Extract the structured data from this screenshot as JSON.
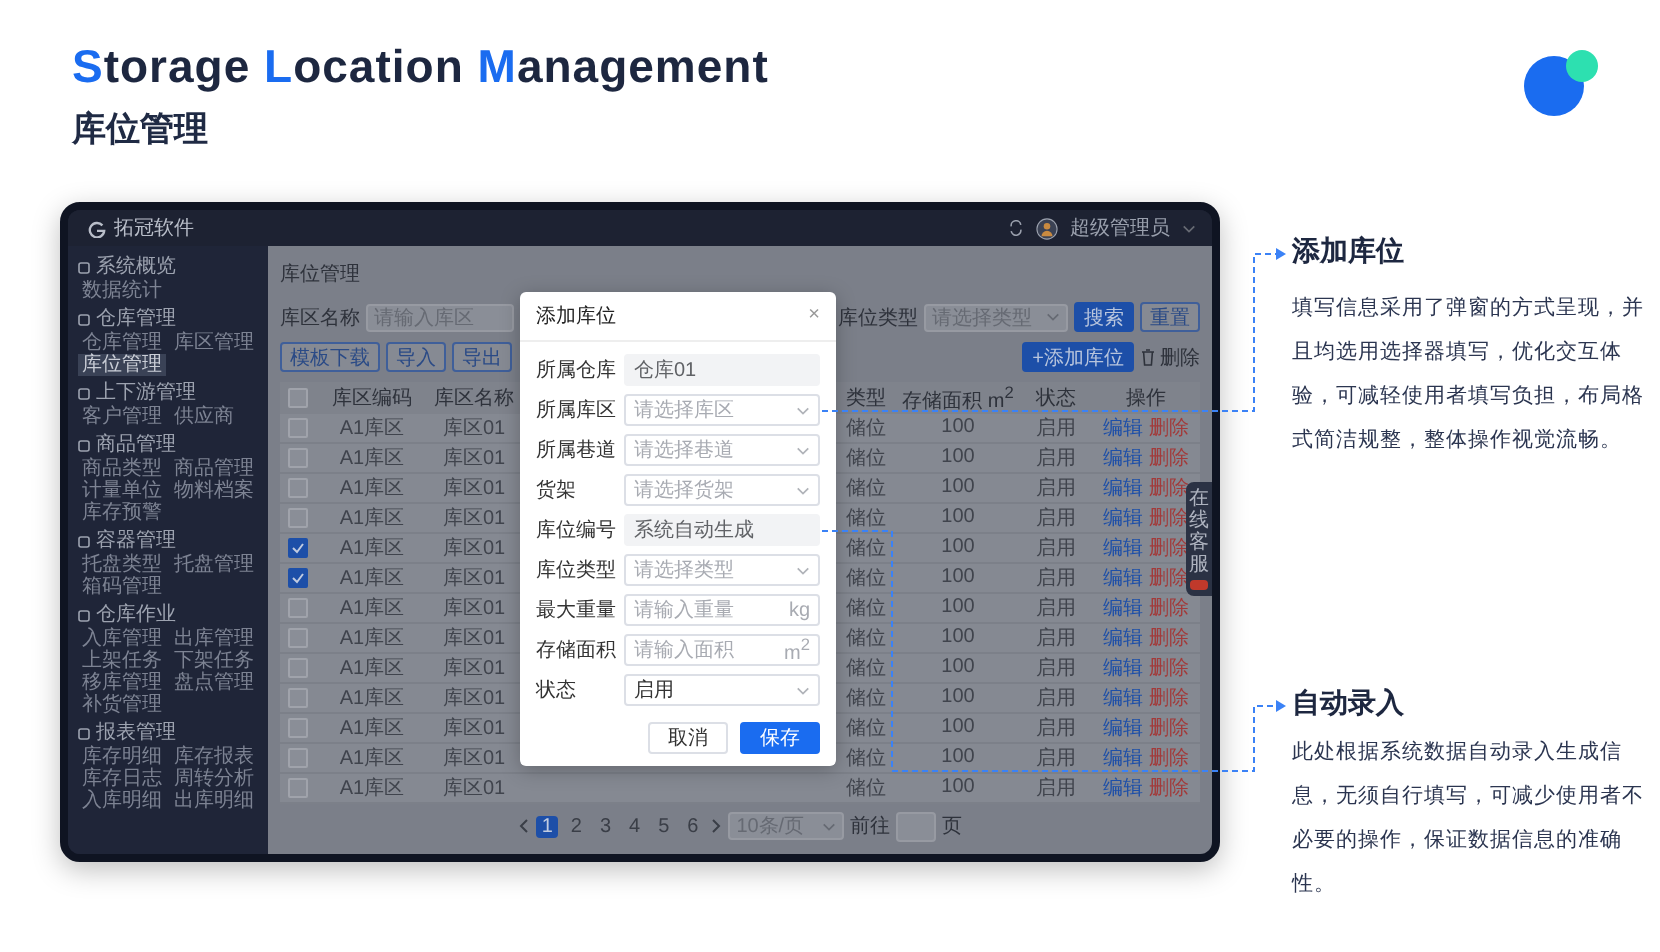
{
  "header": {
    "title_words": [
      {
        "initial": "S",
        "rest": "torage"
      },
      {
        "initial": "L",
        "rest": "ocation"
      },
      {
        "initial": "M",
        "rest": "anagement"
      }
    ],
    "subtitle": "库位管理"
  },
  "app": {
    "brand": "拓冠软件",
    "user": "超级管理员",
    "sidebar": [
      {
        "title": "系统概览",
        "items": [
          {
            "label": "数据统计",
            "selected": false
          }
        ]
      },
      {
        "title": "仓库管理",
        "items": [
          {
            "label": "仓库管理",
            "selected": false
          },
          {
            "label": "库区管理",
            "selected": false
          },
          {
            "label": "库位管理",
            "selected": true
          }
        ]
      },
      {
        "title": "上下游管理",
        "items": [
          {
            "label": "客户管理",
            "selected": false
          },
          {
            "label": "供应商",
            "selected": false
          }
        ]
      },
      {
        "title": "商品管理",
        "items": [
          {
            "label": "商品类型",
            "selected": false
          },
          {
            "label": "商品管理",
            "selected": false
          },
          {
            "label": "计量单位",
            "selected": false
          },
          {
            "label": "物料档案",
            "selected": false
          },
          {
            "label": "库存预警",
            "selected": false
          }
        ]
      },
      {
        "title": "容器管理",
        "items": [
          {
            "label": "托盘类型",
            "selected": false
          },
          {
            "label": "托盘管理",
            "selected": false
          },
          {
            "label": "箱码管理",
            "selected": false
          }
        ]
      },
      {
        "title": "仓库作业",
        "items": [
          {
            "label": "入库管理",
            "selected": false
          },
          {
            "label": "出库管理",
            "selected": false
          },
          {
            "label": "上架任务",
            "selected": false
          },
          {
            "label": "下架任务",
            "selected": false
          },
          {
            "label": "移库管理",
            "selected": false
          },
          {
            "label": "盘点管理",
            "selected": false
          },
          {
            "label": "补货管理",
            "selected": false
          }
        ]
      },
      {
        "title": "报表管理",
        "items": [
          {
            "label": "库存明细",
            "selected": false
          },
          {
            "label": "库存报表",
            "selected": false
          },
          {
            "label": "库存日志",
            "selected": false
          },
          {
            "label": "周转分析",
            "selected": false
          },
          {
            "label": "入库明细",
            "selected": false
          },
          {
            "label": "出库明细",
            "selected": false
          }
        ]
      }
    ],
    "page_title": "库位管理",
    "filters": [
      {
        "label": "库区名称",
        "kind": "input",
        "placeholder": "请输入库区"
      },
      {
        "label": "库位类型",
        "kind": "select",
        "placeholder": "请选择类型"
      }
    ],
    "search_button": "搜索",
    "reset_button": "重置",
    "toolbar": [
      "模板下载",
      "导入",
      "导出"
    ],
    "add_button": "+添加库位",
    "delete_button": "删除",
    "table": {
      "all_checked": false,
      "columns": [
        "库区编码",
        "库区名称",
        "类型",
        "存储面积 m$^{2}$",
        "状态",
        "操作"
      ],
      "rows": [
        {
          "checked": false,
          "code": "A1库区",
          "name": "库区01",
          "type": "储位",
          "area": "100",
          "status": "启用",
          "actions": [
            "编辑",
            "删除"
          ]
        },
        {
          "checked": false,
          "code": "A1库区",
          "name": "库区01",
          "type": "储位",
          "area": "100",
          "status": "启用",
          "actions": [
            "编辑",
            "删除"
          ]
        },
        {
          "checked": false,
          "code": "A1库区",
          "name": "库区01",
          "type": "储位",
          "area": "100",
          "status": "启用",
          "actions": [
            "编辑",
            "删除"
          ]
        },
        {
          "checked": false,
          "code": "A1库区",
          "name": "库区01",
          "type": "储位",
          "area": "100",
          "status": "启用",
          "actions": [
            "编辑",
            "删除"
          ]
        },
        {
          "checked": true,
          "code": "A1库区",
          "name": "库区01",
          "type": "储位",
          "area": "100",
          "status": "启用",
          "actions": [
            "编辑",
            "删除"
          ]
        },
        {
          "checked": true,
          "code": "A1库区",
          "name": "库区01",
          "type": "储位",
          "area": "100",
          "status": "启用",
          "actions": [
            "编辑",
            "删除"
          ]
        },
        {
          "checked": false,
          "code": "A1库区",
          "name": "库区01",
          "type": "储位",
          "area": "100",
          "status": "启用",
          "actions": [
            "编辑",
            "删除"
          ]
        },
        {
          "checked": false,
          "code": "A1库区",
          "name": "库区01",
          "type": "储位",
          "area": "100",
          "status": "启用",
          "actions": [
            "编辑",
            "删除"
          ]
        },
        {
          "checked": false,
          "code": "A1库区",
          "name": "库区01",
          "type": "储位",
          "area": "100",
          "status": "启用",
          "actions": [
            "编辑",
            "删除"
          ]
        },
        {
          "checked": false,
          "code": "A1库区",
          "name": "库区01",
          "type": "储位",
          "area": "100",
          "status": "启用",
          "actions": [
            "编辑",
            "删除"
          ]
        },
        {
          "checked": false,
          "code": "A1库区",
          "name": "库区01",
          "type": "储位",
          "area": "100",
          "status": "启用",
          "actions": [
            "编辑",
            "删除"
          ]
        },
        {
          "checked": false,
          "code": "A1库区",
          "name": "库区01",
          "type": "储位",
          "area": "100",
          "status": "启用",
          "actions": [
            "编辑",
            "删除"
          ]
        },
        {
          "checked": false,
          "code": "A1库区",
          "name": "库区01",
          "type": "储位",
          "area": "100",
          "status": "启用",
          "actions": [
            "编辑",
            "删除"
          ]
        }
      ]
    },
    "pagination": {
      "pages": [
        {
          "label": "1",
          "selected": true
        },
        {
          "label": "2",
          "selected": false
        },
        {
          "label": "3",
          "selected": false
        },
        {
          "label": "4",
          "selected": false
        },
        {
          "label": "5",
          "selected": false
        },
        {
          "label": "6",
          "selected": false
        }
      ],
      "page_size": "10条/页",
      "goto_label": "前往",
      "page_suffix": "页"
    },
    "side_tab": {
      "text": "在线客服"
    },
    "modal": {
      "title": "添加库位",
      "close": "×",
      "fields": [
        {
          "label": "所属仓库",
          "kind": "readonly",
          "value": "仓库01"
        },
        {
          "label": "所属库区",
          "kind": "select",
          "placeholder": "请选择库区"
        },
        {
          "label": "所属巷道",
          "kind": "select",
          "placeholder": "请选择巷道"
        },
        {
          "label": "货架",
          "kind": "select",
          "placeholder": "请选择货架"
        },
        {
          "label": "库位编号",
          "kind": "readonly",
          "value": "系统自动生成"
        },
        {
          "label": "库位类型",
          "kind": "select",
          "placeholder": "请选择类型"
        },
        {
          "label": "最大重量",
          "kind": "input",
          "placeholder": "请输入重量",
          "suffix": "kg"
        },
        {
          "label": "存储面积",
          "kind": "input",
          "placeholder": "请输入面积",
          "suffix": "m$^{2}$"
        },
        {
          "label": "状态",
          "kind": "select",
          "value": "启用"
        }
      ],
      "buttons": [
        {
          "label": "取消",
          "kind": "secondary"
        },
        {
          "label": "保存",
          "kind": "primary"
        }
      ]
    }
  },
  "callouts": [
    {
      "title": "添加库位",
      "text": "填写信息采用了弹窗的方式呈现，并且均选用选择器填写，优化交互体验，可减轻使用者填写负担，布局格式简洁规整，整体操作视觉流畅。"
    },
    {
      "title": "自动录入",
      "text": "此处根据系统数据自动录入生成信息，无须自行填写，可减少使用者不必要的操作，保证数据信息的准确性。"
    }
  ]
}
